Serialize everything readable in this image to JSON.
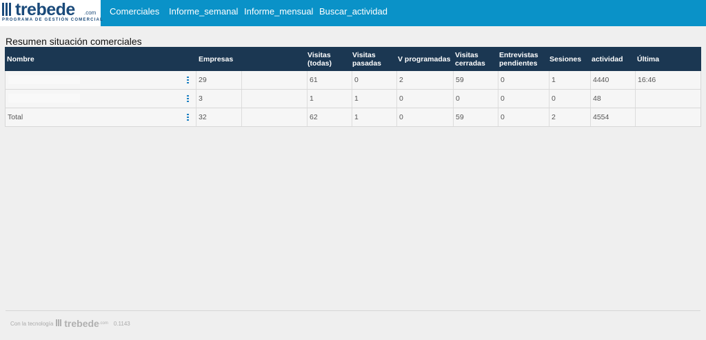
{
  "brand": {
    "logo_word": "trebede",
    "logo_suffix": ".com",
    "tagline": "PROGRAMA DE GESTIÓN COMERCIAL",
    "accent_color": "#0a92c8",
    "header_color": "#1b3752"
  },
  "nav": {
    "items": [
      {
        "label": "Comerciales"
      },
      {
        "label": "Informe_semanal"
      },
      {
        "label": "Informe_mensual"
      },
      {
        "label": "Buscar_actividad"
      }
    ]
  },
  "page": {
    "title": "Resumen situación comerciales"
  },
  "table": {
    "headers": {
      "nombre": "Nombre",
      "empresas": "Empresas",
      "visitas_todas_1": "Visitas",
      "visitas_todas_2": "(todas)",
      "visitas_pasadas_1": "Visitas",
      "visitas_pasadas_2": "pasadas",
      "v_programadas": "V programadas",
      "visitas_cerradas_1": "Visitas",
      "visitas_cerradas_2": "cerradas",
      "entrevistas_1": "Entrevistas",
      "entrevistas_2": "pendientes",
      "sesiones": "Sesiones",
      "actividad": "actividad",
      "ultima": "Última"
    },
    "rows": [
      {
        "nombre": "",
        "empresas": "29",
        "visitas_todas": "61",
        "visitas_pasadas": "0",
        "v_programadas": "2",
        "visitas_cerradas": "59",
        "entrevistas": "0",
        "sesiones": "1",
        "actividad": "4440",
        "ultima": "16:46"
      },
      {
        "nombre": "",
        "empresas": "3",
        "visitas_todas": "1",
        "visitas_pasadas": "1",
        "v_programadas": "0",
        "visitas_cerradas": "0",
        "entrevistas": "0",
        "sesiones": "0",
        "actividad": "48",
        "ultima": ""
      },
      {
        "nombre": "Total",
        "empresas": "32",
        "visitas_todas": "62",
        "visitas_pasadas": "1",
        "v_programadas": "0",
        "visitas_cerradas": "59",
        "entrevistas": "0",
        "sesiones": "2",
        "actividad": "4554",
        "ultima": ""
      }
    ]
  },
  "footer": {
    "prefix": "Con la tecnología",
    "logo_word": "trebede",
    "logo_suffix": ".com",
    "version": "0.1143"
  }
}
